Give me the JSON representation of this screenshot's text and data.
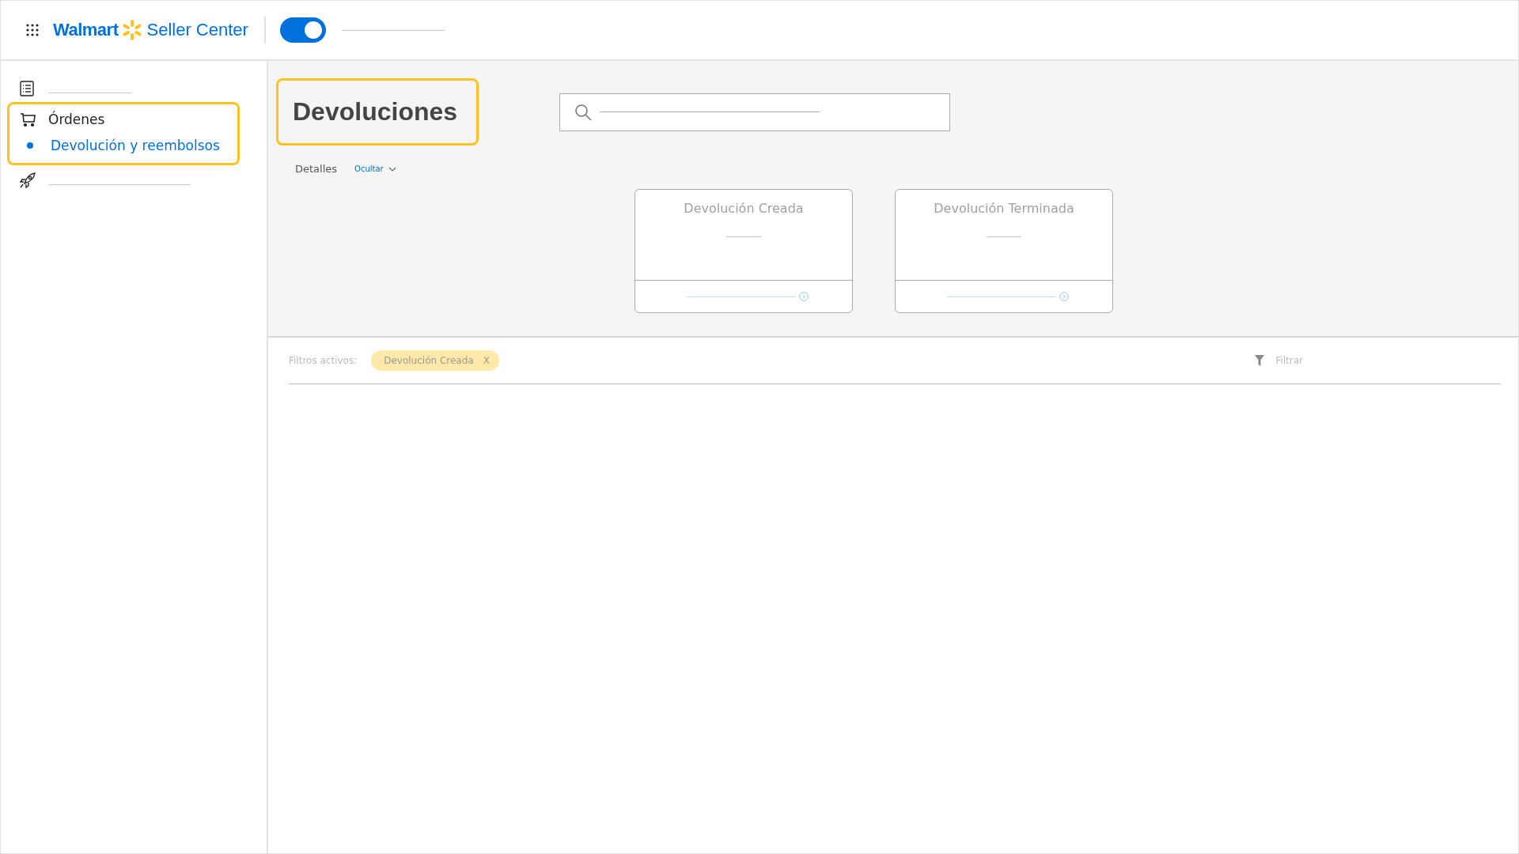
{
  "header": {
    "logo_brand": "Walmart",
    "logo_product": "Seller Center",
    "toggle": {
      "on": true
    }
  },
  "sidebar": {
    "items": [
      {
        "kind": "blank"
      },
      {
        "kind": "group",
        "label": "Órdenes",
        "highlighted": true,
        "children": [
          {
            "label": "Devolución y reembolsos",
            "selected": true
          }
        ]
      },
      {
        "kind": "blank"
      }
    ]
  },
  "page": {
    "title": "Devoluciones",
    "title_highlighted": true,
    "details_label": "Detalles",
    "details_toggle": "Ocultar",
    "cards": [
      {
        "title": "Devolución Creada"
      },
      {
        "title": "Devolución Terminada"
      }
    ]
  },
  "filters": {
    "label": "Filtros activos:",
    "chips": [
      {
        "label": "Devolución Creada",
        "remove": "X"
      }
    ],
    "filter_button": "Filtrar"
  }
}
